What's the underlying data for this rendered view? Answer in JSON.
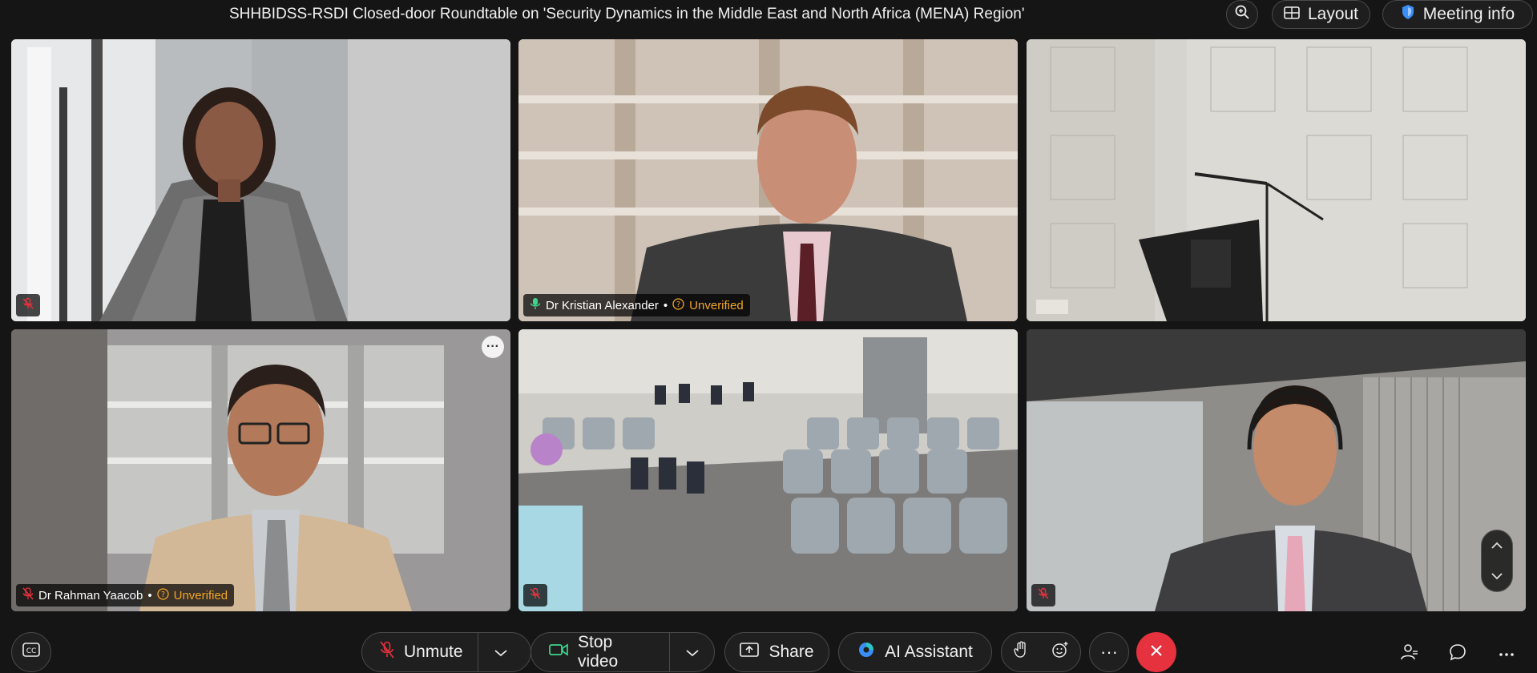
{
  "meeting": {
    "title": "SHHBIDSS-RSDI Closed-door Roundtable on 'Security Dynamics in the Middle East and North Africa (MENA) Region'"
  },
  "topbar": {
    "zoom_icon": "zoom-in-icon",
    "layout_label": "Layout",
    "meeting_info_label": "Meeting info"
  },
  "participants": [
    {
      "name": "",
      "verified": "",
      "audio": "muted"
    },
    {
      "name": "Dr Kristian Alexander",
      "separator": "•",
      "verified": "Unverified",
      "audio": "speaking"
    },
    {
      "name": "",
      "verified": "",
      "audio": "none"
    },
    {
      "name": "Dr Rahman Yaacob",
      "separator": "•",
      "verified": "Unverified",
      "audio": "muted",
      "menu": "···"
    },
    {
      "name": "",
      "verified": "",
      "audio": "muted"
    },
    {
      "name": "",
      "verified": "",
      "audio": "muted"
    }
  ],
  "controls": {
    "unmute_label": "Unmute",
    "stop_video_label": "Stop video",
    "share_label": "Share",
    "ai_assistant_label": "AI Assistant",
    "more_label": "···"
  },
  "colors": {
    "background": "#151515",
    "active_speaker": "#2ec4c4",
    "unverified": "#f5a623",
    "leave": "#e5323e",
    "video_on": "#3dd68c"
  }
}
